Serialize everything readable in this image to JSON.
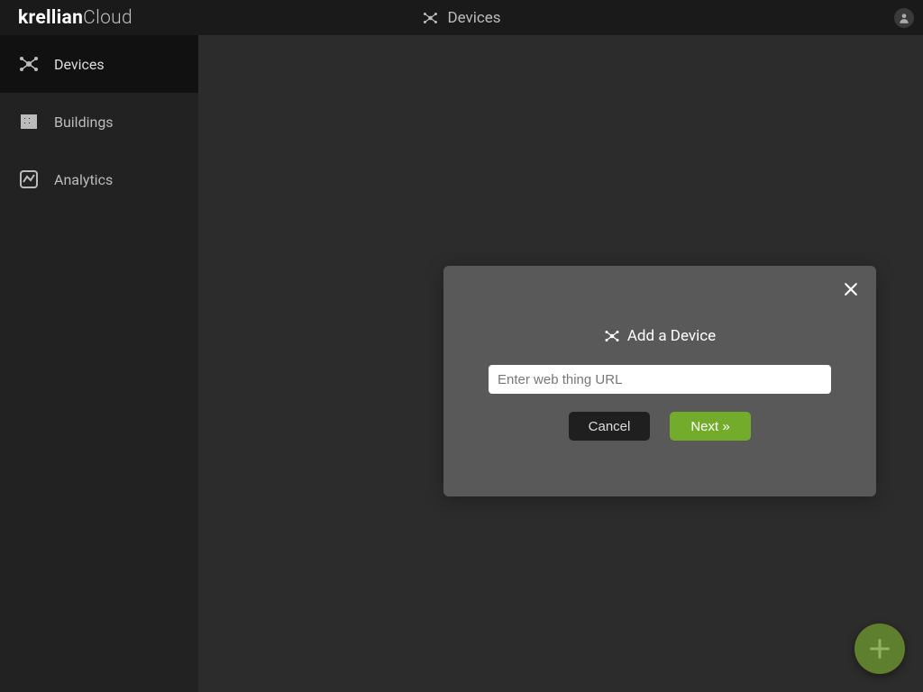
{
  "brand": {
    "bold": "krellian",
    "light": "Cloud"
  },
  "header": {
    "title": "Devices"
  },
  "sidebar": {
    "items": [
      {
        "label": "Devices",
        "name": "sidebar-item-devices",
        "active": true
      },
      {
        "label": "Buildings",
        "name": "sidebar-item-buildings",
        "active": false
      },
      {
        "label": "Analytics",
        "name": "sidebar-item-analytics",
        "active": false
      }
    ]
  },
  "modal": {
    "title": "Add a Device",
    "url_placeholder": "Enter web thing URL",
    "url_value": "",
    "cancel_label": "Cancel",
    "next_label": "Next »"
  },
  "colors": {
    "accent_green": "#73ac2b",
    "fab_green": "#5e7f2d",
    "bg_dark": "#2c2c2c",
    "sidebar_bg": "#222222",
    "header_bg": "#1a1a1a",
    "modal_bg": "#595959"
  }
}
